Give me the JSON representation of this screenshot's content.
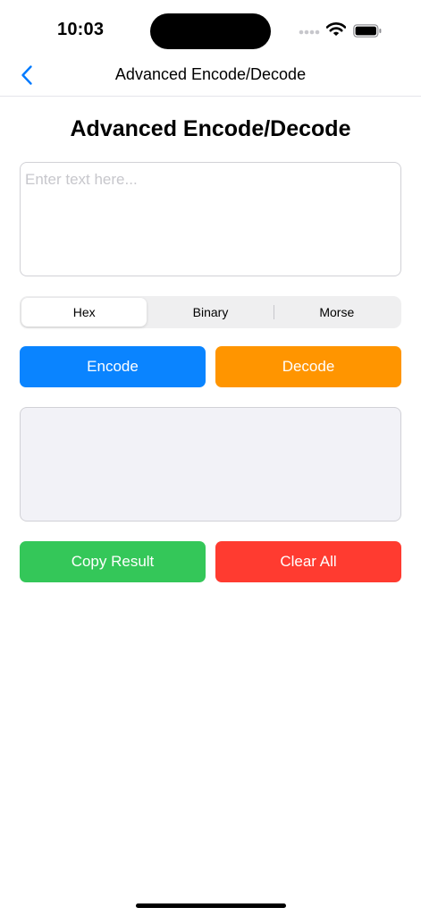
{
  "status_bar": {
    "time": "10:03"
  },
  "nav": {
    "title": "Advanced Encode/Decode",
    "back_icon": "chevron-left-icon"
  },
  "page": {
    "title": "Advanced Encode/Decode"
  },
  "input": {
    "value": "",
    "placeholder": "Enter text here..."
  },
  "modes": {
    "options": [
      "Hex",
      "Binary",
      "Morse"
    ],
    "selected": "Hex"
  },
  "actions": {
    "encode_label": "Encode",
    "decode_label": "Decode",
    "copy_label": "Copy Result",
    "clear_label": "Clear All"
  },
  "result": {
    "value": ""
  },
  "colors": {
    "accent": "#007AFF",
    "encode": "#0A84FF",
    "decode": "#FF9500",
    "copy": "#34C759",
    "clear": "#FF3B30"
  }
}
